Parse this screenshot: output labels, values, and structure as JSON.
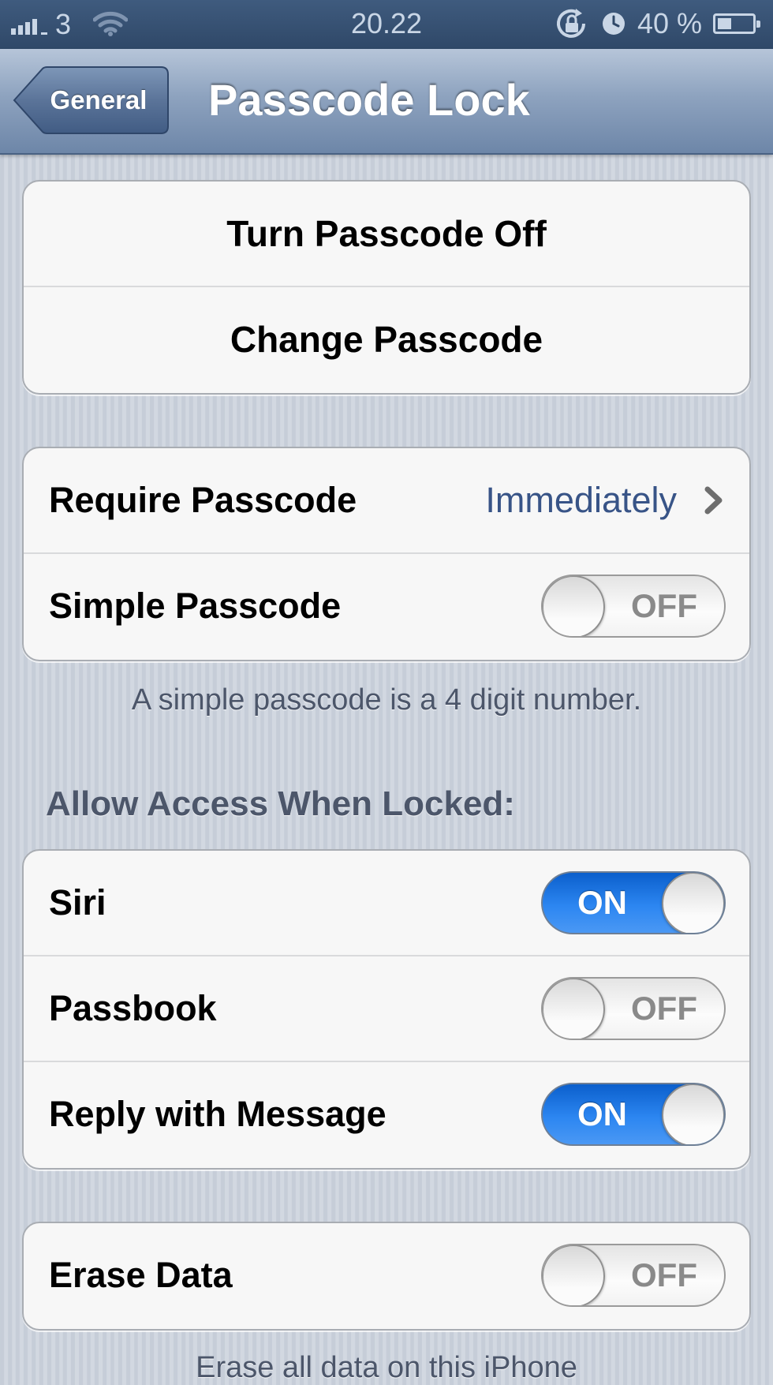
{
  "status_bar": {
    "carrier": "3",
    "time": "20.22",
    "battery_percent_label": "40 %",
    "battery_level": 0.4
  },
  "nav": {
    "back_label": "General",
    "title": "Passcode Lock"
  },
  "passcode_group": {
    "turn_off_label": "Turn Passcode Off",
    "change_label": "Change Passcode"
  },
  "settings_group": {
    "require_label": "Require Passcode",
    "require_value": "Immediately",
    "simple_label": "Simple Passcode",
    "simple_state": "OFF",
    "footnote": "A simple passcode is a 4 digit number."
  },
  "access_group": {
    "header": "Allow Access When Locked:",
    "siri_label": "Siri",
    "siri_state": "ON",
    "passbook_label": "Passbook",
    "passbook_state": "OFF",
    "reply_label": "Reply with Message",
    "reply_state": "ON"
  },
  "erase_group": {
    "erase_label": "Erase Data",
    "erase_state": "OFF",
    "footnote_partial": "Erase all data on this iPhone"
  },
  "colors": {
    "switch_on": "#2c86f1",
    "value_text": "#385487",
    "nav_bar": "#8ea3bf"
  }
}
